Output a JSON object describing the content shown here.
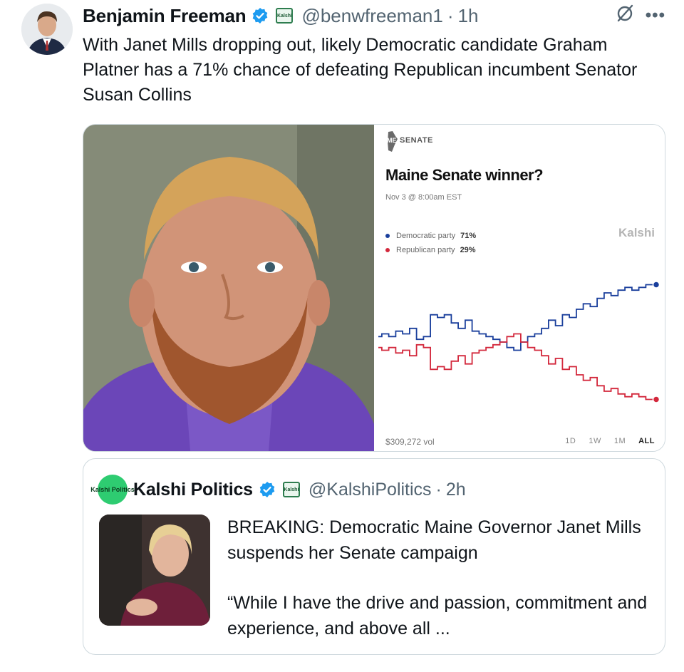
{
  "tweet": {
    "author_name": "Benjamin Freeman",
    "handle": "@benwfreeman1",
    "separator": "·",
    "time": "1h",
    "badge_org": "Kalshi",
    "text": "With Janet Mills dropping out, likely Democratic candidate Graham Platner has a 71% chance of defeating Republican incumbent Senator Susan Collins"
  },
  "media": {
    "photo_icon": "person-photo",
    "chart_card": {
      "section": "SENATE",
      "state": "ME",
      "title": "Maine Senate winner?",
      "date": "Nov 3 @ 8:00am EST",
      "brand": "Kalshi",
      "volume": "$309,272 vol",
      "ranges": [
        "1D",
        "1W",
        "1M",
        "ALL"
      ],
      "active_range": "ALL"
    }
  },
  "chart_data": {
    "type": "line",
    "x": [
      0,
      1,
      2,
      3,
      4,
      5,
      6,
      7,
      8,
      9,
      10,
      11,
      12,
      13,
      14,
      15,
      16,
      17,
      18,
      19,
      20,
      21,
      22,
      23,
      24,
      25,
      26,
      27,
      28,
      29,
      30,
      31,
      32,
      33,
      34,
      35,
      36,
      37,
      38,
      39,
      40
    ],
    "series": [
      {
        "name": "Democratic party",
        "label": "71%",
        "color": "#1a3f9c",
        "values": [
          52,
          53,
          52,
          54,
          53,
          55,
          51,
          52,
          60,
          59,
          60,
          57,
          55,
          58,
          54,
          53,
          52,
          51,
          50,
          48,
          47,
          50,
          52,
          53,
          55,
          58,
          56,
          60,
          59,
          62,
          64,
          63,
          66,
          68,
          67,
          69,
          70,
          69,
          70,
          71,
          71
        ]
      },
      {
        "name": "Republican party",
        "label": "29%",
        "color": "#d3283c",
        "values": [
          48,
          47,
          48,
          46,
          47,
          45,
          49,
          48,
          40,
          41,
          40,
          43,
          45,
          42,
          46,
          47,
          48,
          49,
          50,
          52,
          53,
          50,
          48,
          47,
          45,
          42,
          44,
          40,
          41,
          38,
          36,
          37,
          34,
          32,
          33,
          31,
          30,
          31,
          30,
          29,
          29
        ]
      }
    ],
    "ylim": [
      20,
      80
    ]
  },
  "quote": {
    "avatar_text": "Kalshi Politics",
    "author_name": "Kalshi Politics",
    "badge_org": "Kalshi",
    "handle": "@KalshiPolitics",
    "separator": "·",
    "time": "2h",
    "paragraph1": "BREAKING: Democratic Maine Governor Janet Mills suspends her Senate campaign",
    "paragraph2": "“While I have the drive and passion, commitment and experience, and above all ..."
  }
}
